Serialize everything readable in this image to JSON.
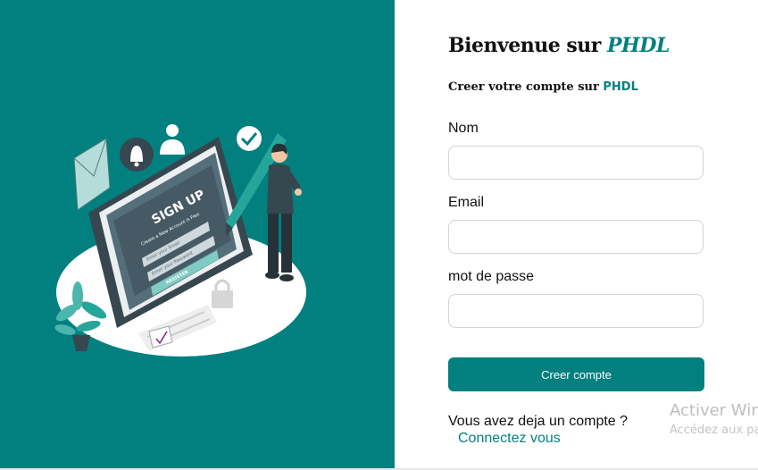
{
  "illustration": {
    "heading": "SIGN UP",
    "tagline": "Create a New Account is Free",
    "email_placeholder": "Enter your Email",
    "password_placeholder": "Enter your Password",
    "register_label": "REGISTER"
  },
  "form": {
    "title_prefix": "Bienvenue sur ",
    "title_brand": "PHDL",
    "subtitle_prefix": "Creer votre compte sur ",
    "subtitle_brand": "PHDL",
    "fields": [
      {
        "label": "Nom",
        "value": ""
      },
      {
        "label": "Email",
        "value": ""
      },
      {
        "label": "mot de passe",
        "value": ""
      }
    ],
    "submit_label": "Creer compte",
    "login_prompt": "Vous avez deja un compte ?",
    "login_link": "Connectez vous"
  },
  "watermark": {
    "title": "Activer Win",
    "subtitle": "Accédez aux pa"
  },
  "colors": {
    "accent": "#028080",
    "background": "#ffffff",
    "text": "#111111"
  }
}
